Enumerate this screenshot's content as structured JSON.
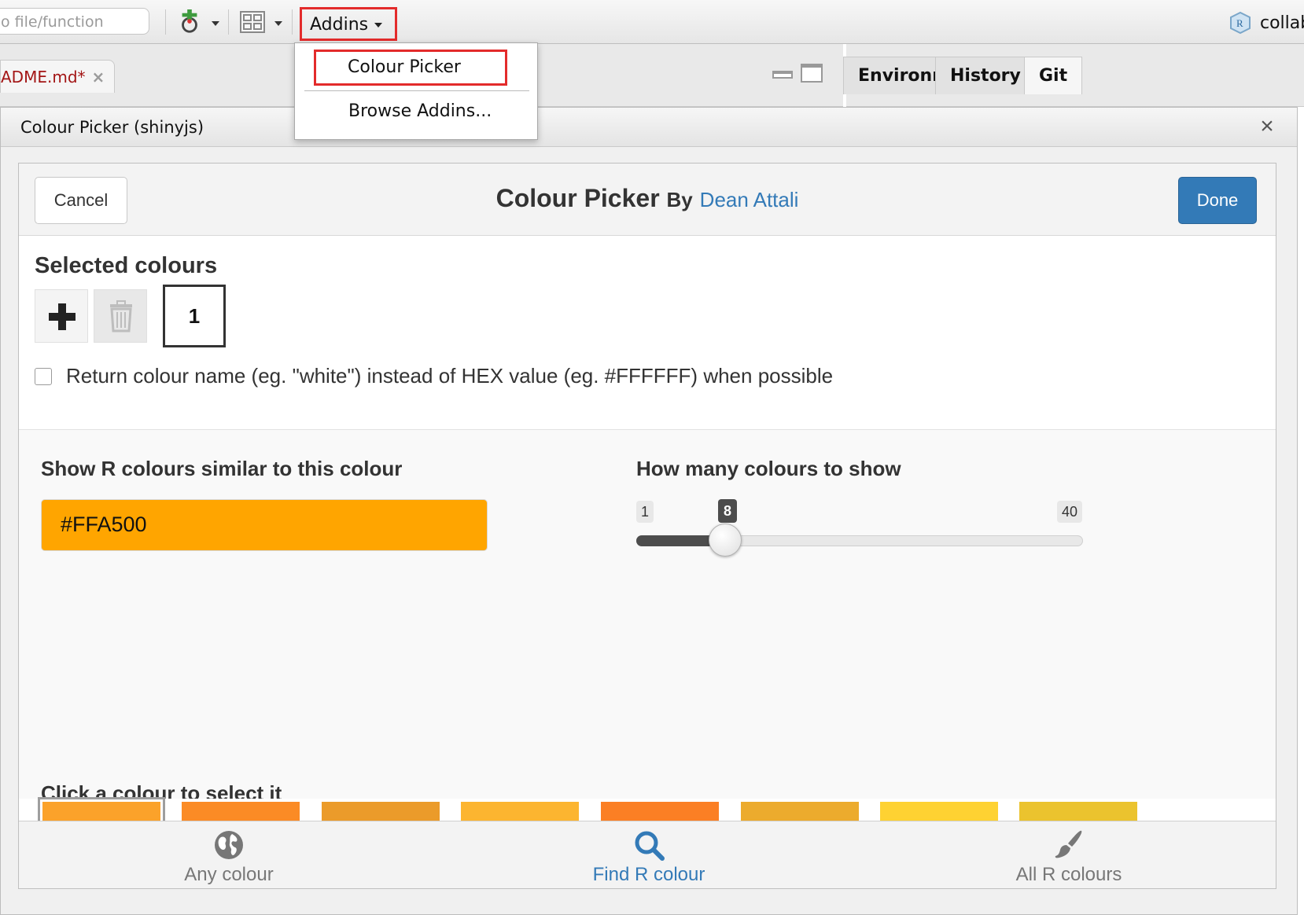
{
  "toolbar": {
    "goto_placeholder": "o file/function",
    "addins_label": "Addins",
    "project_label": "collab"
  },
  "editor": {
    "file_tab": "ADME.md*",
    "file_tab_close": "×"
  },
  "env_pane": {
    "tabs": [
      "Environment",
      "History",
      "Git"
    ],
    "active_tab": "Git"
  },
  "addins_menu": {
    "items": [
      "Colour Picker",
      "Browse Addins..."
    ],
    "highlighted": "Colour Picker"
  },
  "dialog": {
    "title": "Colour Picker (shinyjs)",
    "close": "×"
  },
  "gadget": {
    "cancel_label": "Cancel",
    "done_label": "Done",
    "title": "Colour Picker",
    "by": "By",
    "author": "Dean Attali",
    "selected_heading": "Selected colours",
    "selected_count_label": "1",
    "return_name_label": "Return colour name (eg. \"white\") instead of HEX value (eg. #FFFFFF) when possible",
    "return_name_checked": false,
    "similar_heading": "Show R colours similar to this colour",
    "hex_value": "#FFA500",
    "count_heading": "How many colours to show",
    "slider": {
      "min": "1",
      "max": "40",
      "value": "8"
    },
    "click_heading": "Click a colour to select it",
    "swatches": [
      "#FBA22A",
      "#FB8B25",
      "#EB9B2A",
      "#FCB530",
      "#FB7F24",
      "#ECAB2D",
      "#FED232",
      "#EBC32E"
    ],
    "selected_swatch_index": 0
  },
  "tabs": {
    "items": [
      {
        "label": "Any colour",
        "icon": "globe-icon"
      },
      {
        "label": "Find R colour",
        "icon": "search-icon"
      },
      {
        "label": "All R colours",
        "icon": "paintbrush-icon"
      }
    ],
    "active_index": 1
  },
  "colors": {
    "done_blue": "#337AB7",
    "highlight_red": "#E32B2B",
    "input_orange": "#FFA500"
  }
}
